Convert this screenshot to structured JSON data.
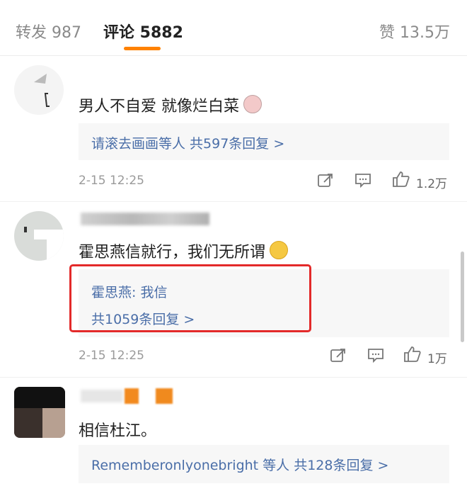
{
  "tabs": {
    "repost": "转发 987",
    "comments": "评论 5882",
    "likes": "赞 13.5万"
  },
  "comments": [
    {
      "text": "男人不自爱 就像烂白菜",
      "replies_summary": "请滚去画画等人 共597条回复 >",
      "time": "2-15 12:25",
      "likes": "1.2万"
    },
    {
      "text": "霍思燕信就行，我们无所谓",
      "reply": "霍思燕: 我信",
      "replies_summary": "共1059条回复 >",
      "time": "2-15 12:25",
      "likes": "1万"
    },
    {
      "text": "相信杜江。",
      "replies_summary": "Rememberonlyonebright 等人 共128条回复 >"
    }
  ],
  "colors": {
    "accent": "#ff8200",
    "link": "#4a6ea8",
    "highlight_frame": "#e32a2a"
  }
}
